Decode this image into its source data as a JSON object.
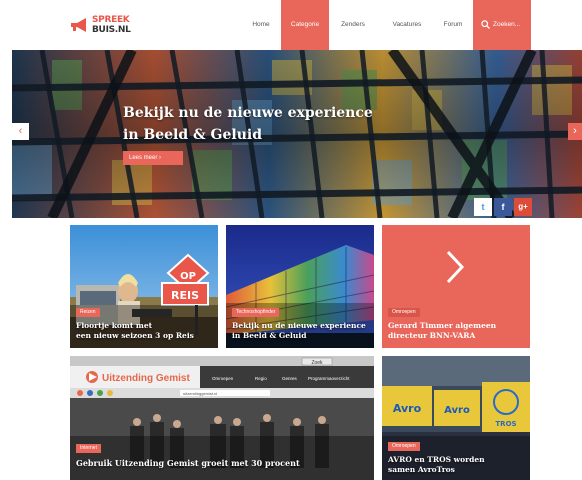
{
  "logo": {
    "line1": "SPREEK",
    "line2": "BUIS.NL"
  },
  "nav": {
    "items": [
      {
        "label": "Home",
        "active": false
      },
      {
        "label": "Categorie",
        "active": true
      },
      {
        "label": "Zenders",
        "active": false
      },
      {
        "label": "Vacatures",
        "active": false
      },
      {
        "label": "Forum",
        "active": false
      }
    ],
    "search_label": "Zoeken..."
  },
  "hero": {
    "title_line1": "Bekijk nu de nieuwe experience",
    "title_line2": "in Beeld & Geluid",
    "button_label": "Lees meer  ›",
    "prev_icon": "‹",
    "next_icon": "›"
  },
  "share": {
    "twitter": "t",
    "facebook": "f",
    "googleplus": "g+"
  },
  "tiles": [
    {
      "badge": "Reizen",
      "line1": "Floortje komt met",
      "line2": "een nieuw seizoen 3 op Reis",
      "sign_top": "OP",
      "sign_bottom": "REIS"
    },
    {
      "badge": "Technoshopfinder",
      "line1": "Bekijk nu de nieuwe experience",
      "line2": "in Beeld & Geluid"
    },
    {
      "badge": "Omroepen",
      "line1": "Gerard Timmer algemeen",
      "line2": "directeur BNN-VARA"
    },
    {
      "badge": "Internet",
      "line1": "Gebruik Uitzending Gemist groeit met 30 procent",
      "screen_title": "Uitzending Gemist",
      "screen_menu": [
        "Omroepen",
        "Regio",
        "Genres",
        "Programmaoverzicht"
      ],
      "screen_url": "uitzendinggemist.nl",
      "screen_btn": "Zoek"
    },
    {
      "badge": "Omroepen",
      "line1": "AVRO en TROS worden",
      "line2": "samen AvroTros",
      "logo_a": "Avro",
      "logo_b": "Avro",
      "logo_c": "TROS"
    }
  ],
  "colors": {
    "accent": "#e8675a",
    "twitter": "#3a9fe0",
    "facebook": "#3b5998",
    "googleplus": "#dd4b39"
  }
}
